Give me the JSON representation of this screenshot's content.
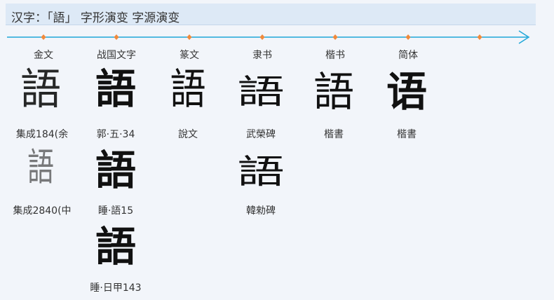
{
  "page": {
    "title": "汉字：「語」 字形演变 字源演变"
  },
  "timeline": {
    "eras": [
      "金文",
      "战国文字",
      "篆文",
      "隶书",
      "楷书",
      "简体"
    ],
    "accent_color": "#1ea6d8",
    "marker_color": "#f08a3c"
  },
  "columns": [
    {
      "era": "金文",
      "entries": [
        {
          "glyph": "語",
          "source": "集成184(余"
        },
        {
          "glyph": "語",
          "source": "集成2840(中"
        }
      ]
    },
    {
      "era": "战国文字",
      "entries": [
        {
          "glyph": "語",
          "source": "郭·五·34"
        },
        {
          "glyph": "語",
          "source": "睡·語15"
        },
        {
          "glyph": "語",
          "source": "睡·日甲143"
        }
      ]
    },
    {
      "era": "篆文",
      "entries": [
        {
          "glyph": "語",
          "source": "說文"
        }
      ]
    },
    {
      "era": "隶书",
      "entries": [
        {
          "glyph": "語",
          "source": "武榮碑"
        },
        {
          "glyph": "語",
          "source": "韓勑碑"
        }
      ]
    },
    {
      "era": "楷书",
      "entries": [
        {
          "glyph": "語",
          "source": "楷書"
        }
      ]
    },
    {
      "era": "简体",
      "entries": [
        {
          "glyph": "语",
          "source": "楷書"
        }
      ]
    }
  ]
}
